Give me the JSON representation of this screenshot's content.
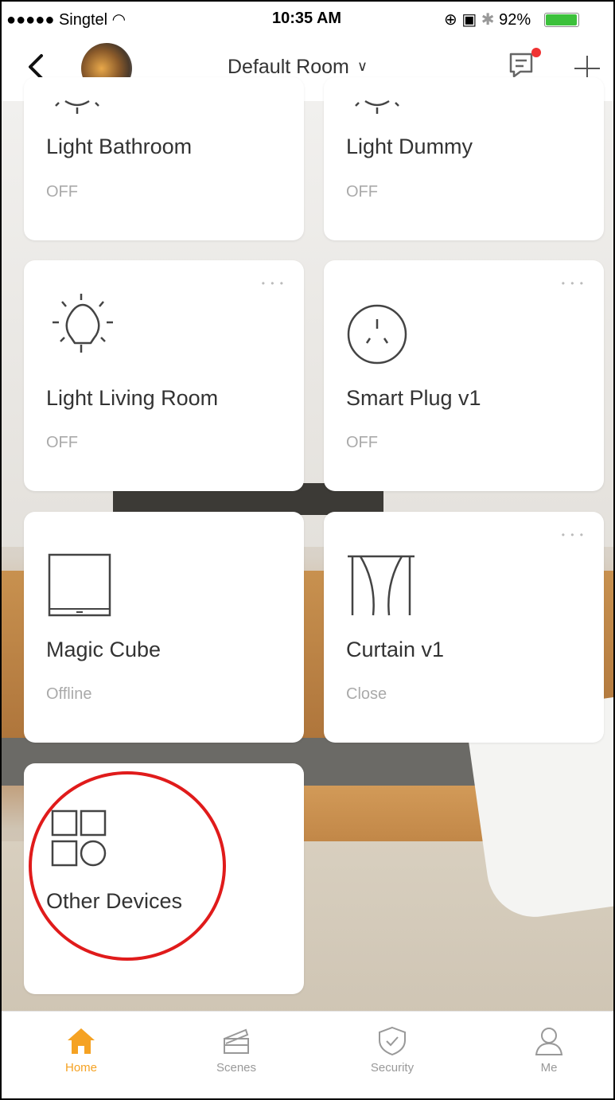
{
  "status_bar": {
    "carrier": "●●●●● Singtel",
    "time": "10:35 AM",
    "battery": "92%",
    "battery_fraction": 0.92
  },
  "header": {
    "room_title": "Default Room",
    "room_chevron_icon": "chevron-down-icon",
    "message_icon": "message-icon",
    "add_icon": "plus-icon"
  },
  "devices": [
    {
      "name": "Light Bathroom",
      "status": "OFF",
      "icon": "bulb-icon"
    },
    {
      "name": "Light Dummy",
      "status": "OFF",
      "icon": "bulb-icon"
    },
    {
      "name": "Light Living Room",
      "status": "OFF",
      "icon": "bulb-icon"
    },
    {
      "name": "Smart Plug v1",
      "status": "OFF",
      "icon": "plug-icon"
    },
    {
      "name": "Magic Cube",
      "status": "Offline",
      "icon": "cube-icon"
    },
    {
      "name": "Curtain v1",
      "status": "Close",
      "icon": "curtain-icon"
    },
    {
      "name": "Other Devices",
      "status": "",
      "icon": "grid-icon"
    }
  ],
  "tabs": [
    {
      "label": "Home",
      "icon": "home-icon",
      "active": true
    },
    {
      "label": "Scenes",
      "icon": "clapper-icon",
      "active": false
    },
    {
      "label": "Security",
      "icon": "shield-icon",
      "active": false
    },
    {
      "label": "Me",
      "icon": "user-icon",
      "active": false
    }
  ],
  "colors": {
    "accent": "#f5a223",
    "annotation": "#e01b1b",
    "badge": "#f03232"
  }
}
